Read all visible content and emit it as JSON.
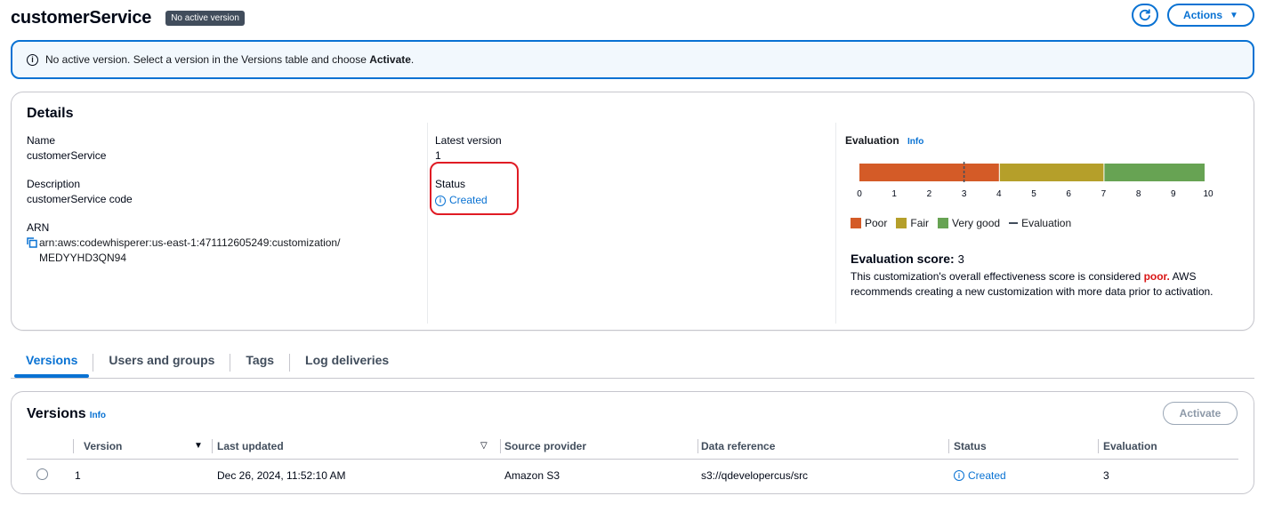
{
  "header": {
    "title": "customerService",
    "badge": "No active version",
    "actions_label": "Actions"
  },
  "alert": {
    "text_prefix": "No active version. Select a version in the Versions table and choose ",
    "text_bold": "Activate",
    "text_suffix": "."
  },
  "details": {
    "title": "Details",
    "name_label": "Name",
    "name_value": "customerService",
    "description_label": "Description",
    "description_value": "customerService code",
    "arn_label": "ARN",
    "arn_line1": "arn:aws:codewhisperer:us-east-1:471112605249:customization/",
    "arn_line2": "MEDYYHD3QN94",
    "latest_version_label": "Latest version",
    "latest_version_value": "1",
    "status_label": "Status",
    "status_value": "Created"
  },
  "evaluation": {
    "title": "Evaluation",
    "info": "Info",
    "scale_ticks": [
      "0",
      "1",
      "2",
      "3",
      "4",
      "5",
      "6",
      "7",
      "8",
      "9",
      "10"
    ],
    "scale_min": 0,
    "scale_max": 10,
    "bands": [
      {
        "name": "Poor",
        "from": 0,
        "to": 4,
        "color": "#d45b27"
      },
      {
        "name": "Fair",
        "from": 4,
        "to": 7,
        "color": "#b59f2a"
      },
      {
        "name": "Very good",
        "from": 7,
        "to": 10,
        "color": "#67a353"
      }
    ],
    "marker_value": 3,
    "legend_evaluation": "Evaluation",
    "score_label": "Evaluation score:",
    "score_value": "3",
    "desc_prefix": "This customization's overall effectiveness score is considered ",
    "desc_poor": "poor.",
    "desc_suffix": " AWS recommends creating a new customization with more data prior to activation."
  },
  "tabs": [
    {
      "label": "Versions",
      "active": true
    },
    {
      "label": "Users and groups",
      "active": false
    },
    {
      "label": "Tags",
      "active": false
    },
    {
      "label": "Log deliveries",
      "active": false
    }
  ],
  "versions": {
    "title": "Versions",
    "info": "Info",
    "activate_label": "Activate",
    "columns": [
      "Version",
      "Last updated",
      "Source provider",
      "Data reference",
      "Status",
      "Evaluation"
    ],
    "rows": [
      {
        "version": "1",
        "last_updated": "Dec 26, 2024, 11:52:10 AM",
        "source_provider": "Amazon S3",
        "data_reference": "s3://qdevelopercus/src",
        "status": "Created",
        "evaluation": "3"
      }
    ]
  }
}
